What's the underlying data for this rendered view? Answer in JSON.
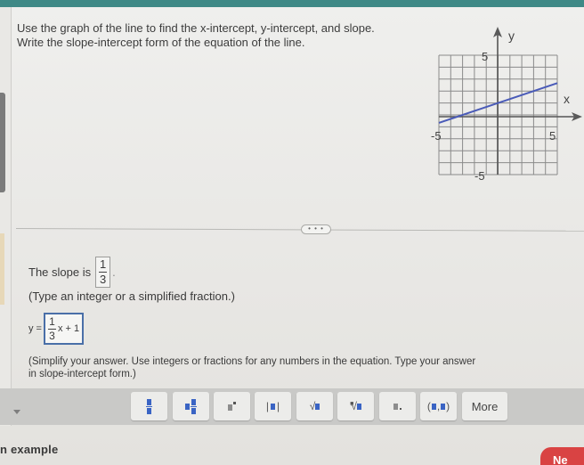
{
  "question": {
    "line1": "Use the graph of the line to find the x-intercept, y-intercept, and slope.",
    "line2": "Write the slope-intercept form of the equation of the line."
  },
  "graph": {
    "x_axis_label": "x",
    "y_axis_label": "y",
    "x_range": [
      -5,
      5
    ],
    "y_range": [
      -5,
      5
    ],
    "tick_labels": {
      "x_min": "-5",
      "x_max": "5",
      "y_max": "5",
      "y_min": "-5"
    },
    "line": {
      "slope": 0.3333,
      "intercept": 1,
      "color": "#4a5bb8"
    }
  },
  "divider": {
    "more_label": "• • •"
  },
  "slope": {
    "prefix": "The slope is",
    "numerator": "1",
    "denominator": "3",
    "suffix": "."
  },
  "hint1": "(Type an integer or a simplified fraction.)",
  "equation": {
    "prefix": "y =",
    "numerator": "1",
    "denominator": "3",
    "rest": "x + 1"
  },
  "hint2": {
    "line1": "(Simplify your answer. Use integers or fractions for any numbers in the equation. Type your answer",
    "line2": "in slope-intercept form.)"
  },
  "toolbar": {
    "buttons": [
      {
        "icon": "fraction-icon"
      },
      {
        "icon": "mixed-number-icon"
      },
      {
        "icon": "exponent-icon"
      },
      {
        "icon": "absolute-value-icon"
      },
      {
        "icon": "square-root-icon"
      },
      {
        "icon": "nth-root-icon"
      },
      {
        "icon": "decimal-icon"
      },
      {
        "icon": "ordered-pair-icon"
      }
    ],
    "more_label": "More"
  },
  "footer": {
    "example_label": "n example",
    "next_label": "Ne"
  }
}
